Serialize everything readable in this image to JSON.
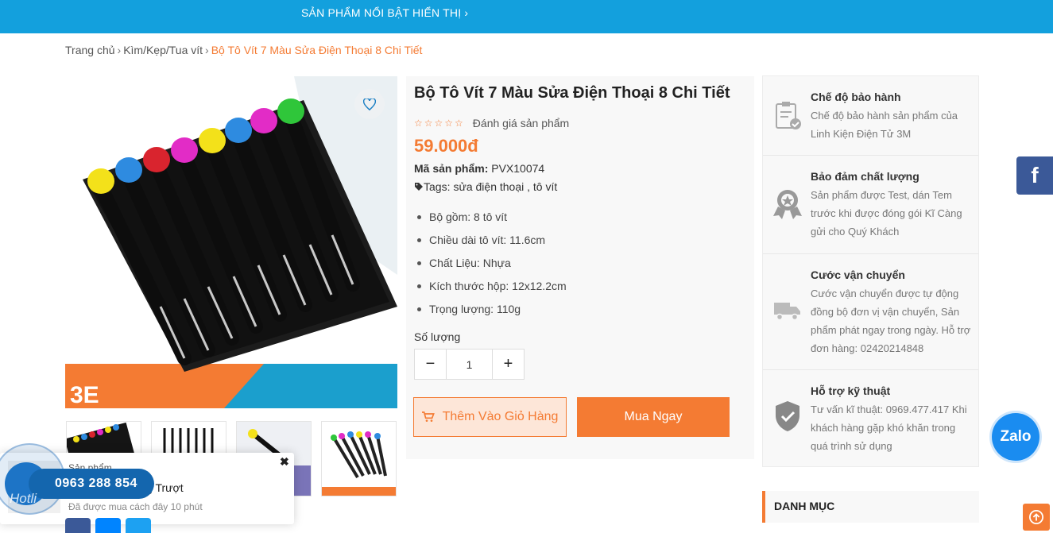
{
  "topbar": {
    "link": "SẢN PHẨM NỔI BẬT HIỂN THỊ ›"
  },
  "breadcrumb": {
    "home": "Trang chủ",
    "category": "Kìm/Kẹp/Tua vít",
    "current": "Bộ Tô Vít 7 Màu Sửa Điện Thoại 8 Chi Tiết"
  },
  "product": {
    "title": "Bộ Tô Vít 7 Màu Sửa Điện Thoại 8 Chi Tiết",
    "rating_label": "Đánh giá sản phẩm",
    "rating_value": 0,
    "price": "59.000đ",
    "sku_label": "Mã sản phẩm:",
    "sku_value": "PVX10074",
    "tags_label": "Tags:",
    "tag_1": "sửa điện thoại",
    "tag_sep": " , ",
    "tag_2": "tô vít",
    "specs": [
      "Bộ gồm: 8 tô vít",
      "Chiều dài tô vít: 11.6cm",
      "Chất Liệu: Nhựa",
      "Kích thước hộp: 12x12.2cm",
      "Trọng lượng: 110g"
    ],
    "qty_label": "Số lượng",
    "qty_value": "1",
    "minus": "−",
    "plus": "+",
    "add_to_cart": "Thêm Vào Giỏ Hàng",
    "buy_now": "Mua Ngay"
  },
  "policies": [
    {
      "icon": "clipboard-check-icon",
      "title": "Chế độ bảo hành",
      "desc": "Chế độ bảo hành sản phẩm của Linh Kiện Điện Tử 3M"
    },
    {
      "icon": "award-badge-icon",
      "title": "Bảo đảm chất lượng",
      "desc": "Sản phẩm được Test, dán Tem trước khi được đóng gói Kĩ Càng gửi cho Quý Khách"
    },
    {
      "icon": "truck-icon",
      "title": "Cước vận chuyển",
      "desc": "Cước vận chuyển được tự động đồng bộ đơn vị vận chuyển, Sản phẩm phát ngay trong ngày. Hỗ trợ đơn hàng: 02420214848"
    },
    {
      "icon": "shield-check-icon",
      "title": "Hỗ trợ kỹ thuật",
      "desc": "Tư vấn kĩ thuật: 0969.477.417 Khi khách hàng gặp khó khăn trong quá trình sử dụng"
    }
  ],
  "sidebar": {
    "danhmuc": "DANH MỤC"
  },
  "floating": {
    "zalo": "Zalo",
    "facebook": "f"
  },
  "popup": {
    "label": "Sản phẩm",
    "product": "6D Có Vỏ Chống Trượt",
    "time": "Đã được mua cách đây 10 phút",
    "close": "✖"
  },
  "hotline": {
    "phone": "0963 288 854",
    "label": "Hotli"
  },
  "colors": {
    "accent": "#f47b33",
    "topbar": "#13a0dd",
    "facebook": "#3b5998",
    "zalo": "#1a8cf0"
  }
}
